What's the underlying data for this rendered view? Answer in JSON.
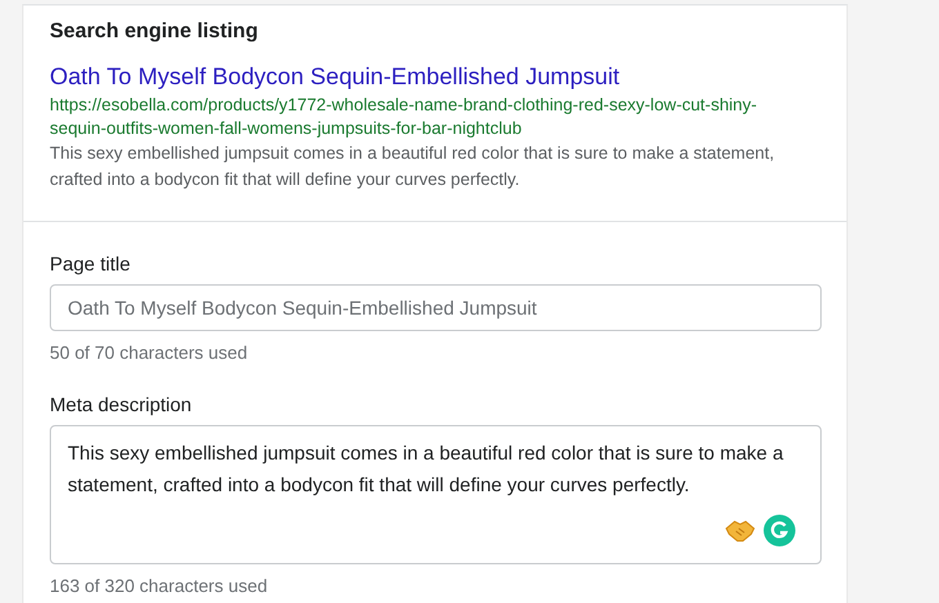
{
  "section": {
    "title": "Search engine listing"
  },
  "preview": {
    "title": "Oath To Myself Bodycon Sequin-Embellished Jumpsuit",
    "url": "https://esobella.com/products/y1772-wholesale-name-brand-clothing-red-sexy-low-cut-shiny-sequin-outfits-women-fall-womens-jumpsuits-for-bar-nightclub",
    "description": "This sexy embellished jumpsuit comes in a beautiful red color that is sure to make a statement, crafted into a bodycon fit that will define your curves perfectly."
  },
  "fields": [
    {
      "kind": "input",
      "label": "Page title",
      "placeholder": "Oath To Myself Bodycon Sequin-Embellished Jumpsuit",
      "counter": "50 of 70 characters used"
    },
    {
      "kind": "textarea",
      "label": "Meta description",
      "value": "This sexy embellished jumpsuit comes in a beautiful red color that is sure to make a statement, crafted into a bodycon fit that will define your curves perfectly.",
      "counter": "163 of 320 characters used"
    }
  ]
}
